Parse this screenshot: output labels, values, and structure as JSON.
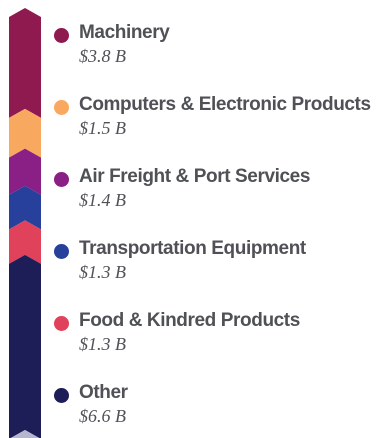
{
  "chart_data": {
    "type": "bar",
    "orientation": "vertical-stacked",
    "unit": "$ B",
    "categories": [
      "Machinery",
      "Computers & Electronic Products",
      "Air Freight & Port Services",
      "Transportation Equipment",
      "Food & Kindred Products",
      "Other"
    ],
    "values": [
      3.8,
      1.5,
      1.4,
      1.3,
      1.3,
      6.6
    ],
    "value_labels": [
      "$3.8 B",
      "$1.5 B",
      "$1.4 B",
      "$1.3 B",
      "$1.3 B",
      "$6.6 B"
    ],
    "colors": [
      "#8e1a4f",
      "#f9a860",
      "#8a1f86",
      "#27409b",
      "#e0415b",
      "#1d1d58"
    ],
    "end_cap_color": "#b5b7cf",
    "title": "",
    "xlabel": "",
    "ylabel": "",
    "legend": "right",
    "grid": false
  }
}
